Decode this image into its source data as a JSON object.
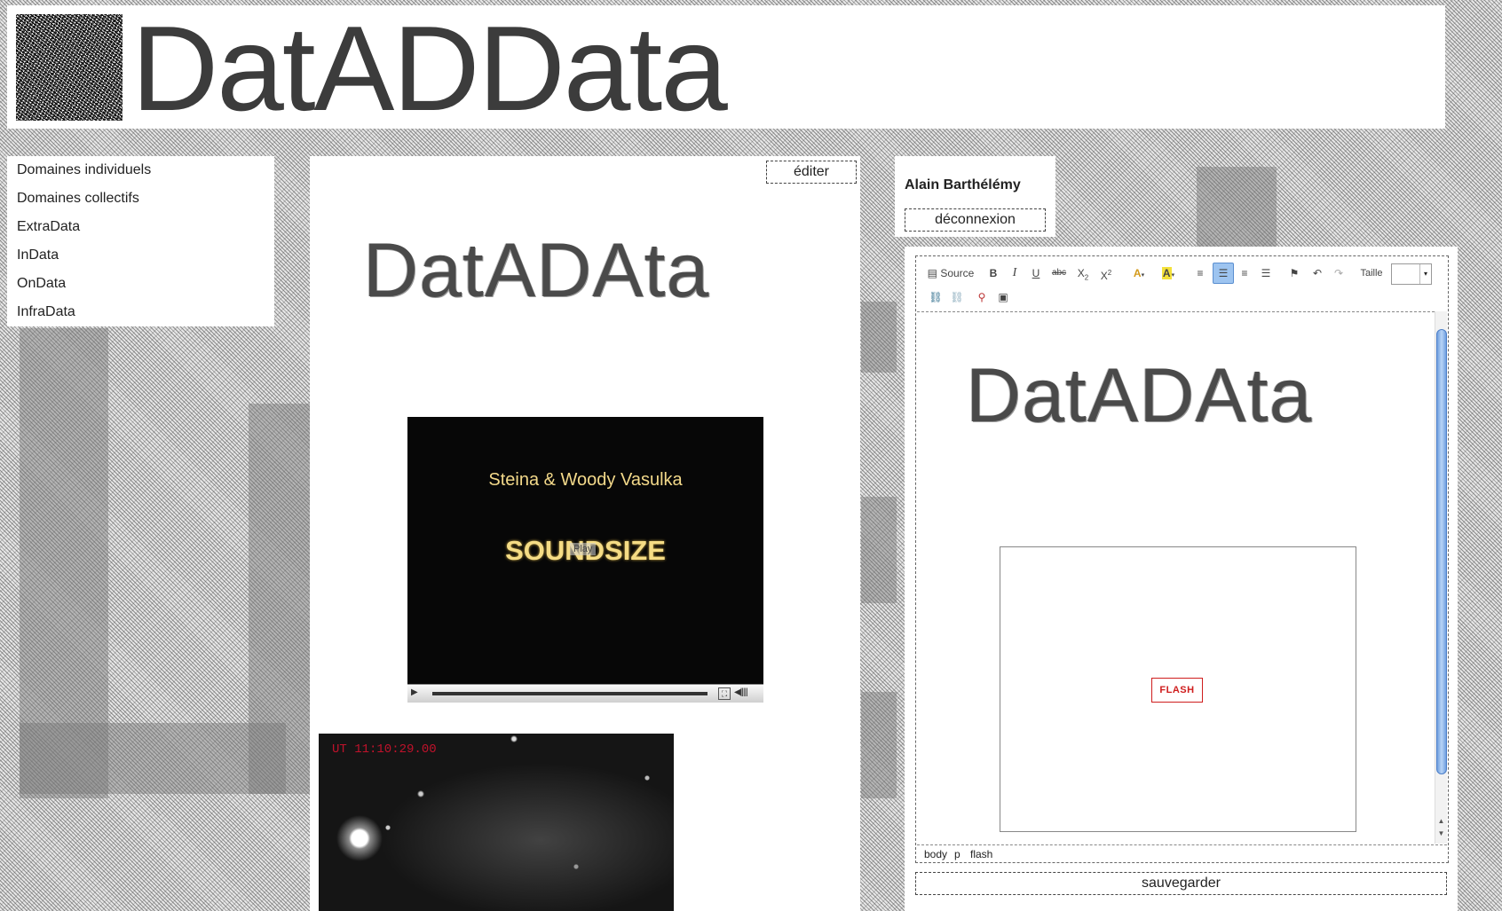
{
  "site": {
    "title": "DatADData"
  },
  "nav": {
    "items": [
      {
        "label": "Domaines individuels"
      },
      {
        "label": "Domaines collectifs"
      },
      {
        "label": "ExtraData"
      },
      {
        "label": "InData"
      },
      {
        "label": "OnData"
      },
      {
        "label": "InfraData"
      }
    ]
  },
  "main": {
    "edit_label": "éditer",
    "content_logo": "DatADAta",
    "video": {
      "title": "Steina & Woody Vasulka",
      "subtitle": "SOUNDSIZE",
      "play_label": "Play"
    },
    "photo": {
      "timestamp": "UT 11:10:29.00"
    }
  },
  "user": {
    "name": "Alain Barthélémy",
    "logout_label": "déconnexion"
  },
  "editor": {
    "toolbar": {
      "source_label": "Source",
      "bold": "B",
      "italic": "I",
      "underline": "U",
      "strike": "abc",
      "subscript_base": "X",
      "subscript": "2",
      "superscript_base": "X",
      "superscript": "2",
      "text_color": "A",
      "bg_color": "A",
      "size_label": "Taille",
      "size_value": "",
      "icons": [
        "source-icon",
        "align-left-icon",
        "align-center-icon",
        "align-right-icon",
        "justify-icon",
        "anchor-icon",
        "undo-icon",
        "redo-icon",
        "link-icon",
        "unlink-icon",
        "image-icon",
        "flash-icon"
      ]
    },
    "content_logo": "DatADAta",
    "flash_label": "FLASH",
    "path": [
      "body",
      "p",
      "flash"
    ],
    "save_label": "sauvegarder"
  },
  "colors": {
    "accent_active": "#9dc4f0",
    "flash_red": "#cf1d1d",
    "video_text": "#f3d98a"
  }
}
